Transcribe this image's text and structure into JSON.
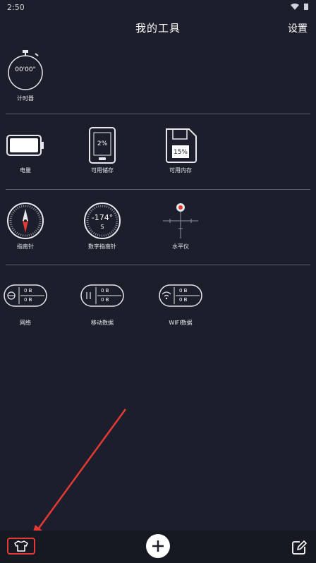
{
  "status": {
    "time": "2:50"
  },
  "header": {
    "title": "我的工具",
    "settings_label": "设置"
  },
  "sections": {
    "timer": {
      "label": "计时器",
      "display": "00'00\""
    },
    "device": {
      "battery_label": "电量",
      "storage_label": "可用储存",
      "storage_value": "2%",
      "memory_label": "可用内存",
      "memory_value": "15%"
    },
    "compass": {
      "compass_label": "指南针",
      "digital_label": "数字指南针",
      "digital_degree": "-174°",
      "digital_direction": "S",
      "level_label": "水平仪"
    },
    "network": {
      "network_label": "网络",
      "mobile_label": "移动数据",
      "wifi_label": "WIFI数据",
      "up_value": "0 B",
      "down_value": "0 B"
    }
  },
  "bottombar": {
    "theme_icon": "tshirt-icon",
    "add_icon": "plus-icon",
    "edit_icon": "edit-icon"
  },
  "colors": {
    "background": "#1c1f2b",
    "highlight": "#e53935",
    "divider": "#5d6170"
  }
}
